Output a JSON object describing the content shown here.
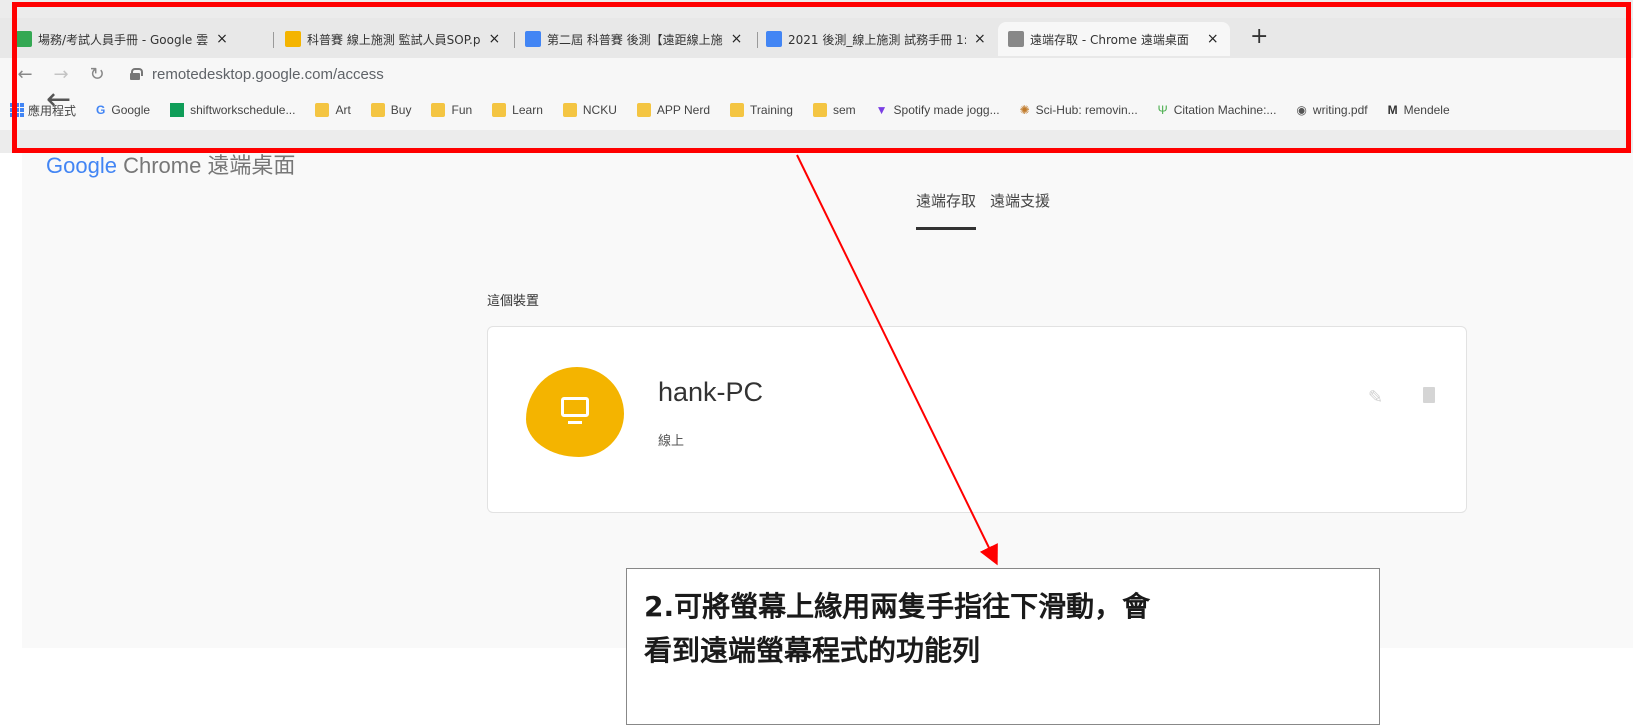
{
  "tabs": [
    {
      "title": "場務/考試人員手冊 - Google 雲",
      "icon_color": "#34a853"
    },
    {
      "title": "科普賽 線上施測 監試人員SOP.p",
      "icon_color": "#f4b400"
    },
    {
      "title": "第二屆 科普賽 後測【遠距線上施",
      "icon_color": "#4285f4"
    },
    {
      "title": "2021 後測_線上施測 試務手冊 1:",
      "icon_color": "#4285f4"
    },
    {
      "title": "遠端存取 - Chrome 遠端桌面",
      "icon_color": "#888888"
    }
  ],
  "tab_close": "×",
  "new_tab": "+",
  "address": {
    "url": "remotedesktop.google.com/access"
  },
  "bookmarks": {
    "apps": "應用程式",
    "items": [
      "Google",
      "shiftworkschedule...",
      "Art",
      "Buy",
      "Fun",
      "Learn",
      "NCKU",
      "APP Nerd",
      "Training",
      "sem",
      "Spotify made jogg...",
      "Sci-Hub: removin...",
      "Citation Machine:...",
      "writing.pdf",
      "Mendele"
    ]
  },
  "page": {
    "logo_google": "Google",
    "logo_rest": "Chrome 遠端桌面",
    "tab_access": "遠端存取",
    "tab_support": "遠端支援",
    "section_title": "這個裝置",
    "device_name": "hank-PC",
    "device_status": "線上"
  },
  "callout": {
    "line1": "2.可將螢幕上緣用兩隻手指往下滑動，會",
    "line2": "看到遠端螢幕程式的功能列"
  },
  "colors": {
    "highlight_box": "#ff0000",
    "arrow": "#ff0000",
    "device_blob": "#f4b400"
  }
}
